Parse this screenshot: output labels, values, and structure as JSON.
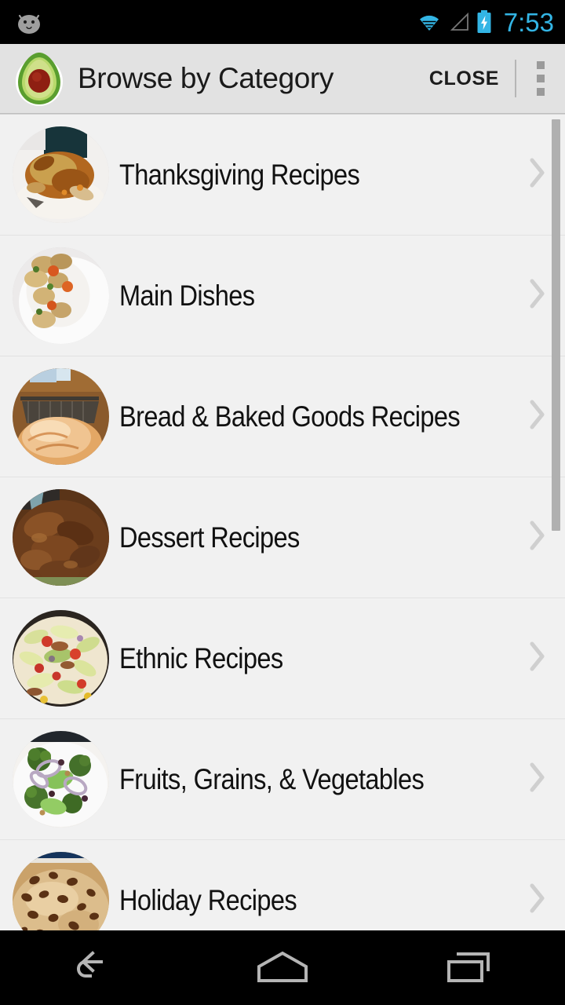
{
  "status_bar": {
    "notification_icon": "android-head-icon",
    "wifi_icon": "wifi-icon",
    "signal_icon": "signal-triangle-icon",
    "battery_icon": "battery-charging-icon",
    "clock": "7:53",
    "accent_color": "#33b5e5",
    "background": "#000000"
  },
  "action_bar": {
    "app_icon": "avocado-icon",
    "title": "Browse by Category",
    "close_label": "CLOSE",
    "overflow_icon": "overflow-menu-icon",
    "background": "#e2e2e2"
  },
  "list": {
    "chevron_icon": "chevron-right-icon",
    "scrollbar": {
      "visible": true
    },
    "items": [
      {
        "label": "Thanksgiving Recipes",
        "thumb": "roast-turkey-photo"
      },
      {
        "label": "Main Dishes",
        "thumb": "chicken-vegetables-plate-photo"
      },
      {
        "label": "Bread & Baked Goods Recipes",
        "thumb": "bread-loaf-photo"
      },
      {
        "label": "Dessert Recipes",
        "thumb": "chocolate-dessert-photo"
      },
      {
        "label": "Ethnic Recipes",
        "thumb": "taco-salad-photo"
      },
      {
        "label": "Fruits, Grains, & Vegetables",
        "thumb": "broccoli-salad-photo"
      },
      {
        "label": "Holiday Recipes",
        "thumb": "raisin-bread-photo"
      }
    ]
  },
  "nav_bar": {
    "back_label": "back-icon",
    "home_label": "home-icon",
    "recents_label": "recents-icon",
    "background": "#000000"
  }
}
